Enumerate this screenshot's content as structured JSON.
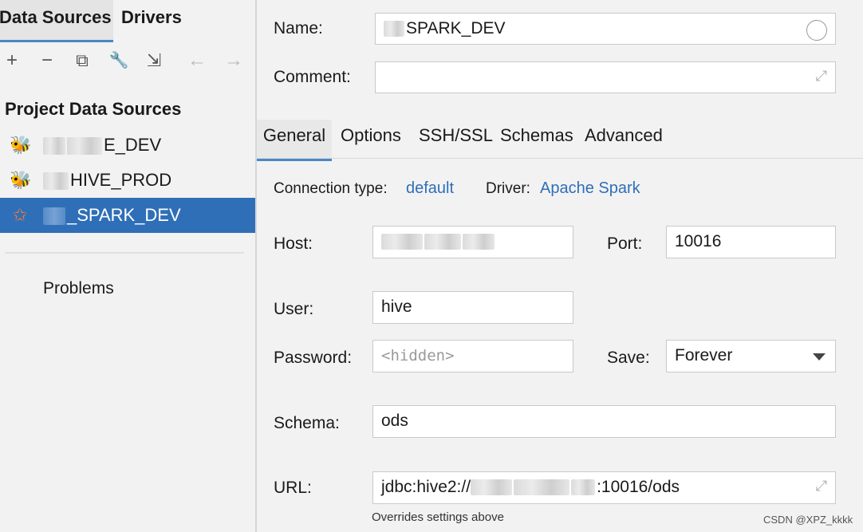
{
  "left": {
    "tabs": [
      {
        "label": "Data Sources",
        "active": true
      },
      {
        "label": "Drivers",
        "active": false
      }
    ],
    "toolbar": {
      "add": "+",
      "remove": "−",
      "duplicate": "⧉",
      "settings": "🔧",
      "import": "⇲",
      "back": "←",
      "forward": "→"
    },
    "section_title": "Project Data Sources",
    "items": [
      {
        "label": "E_DEV",
        "icon": "hive-icon",
        "selected": false
      },
      {
        "label": "HIVE_PROD",
        "icon": "hive-icon",
        "selected": false
      },
      {
        "label": "_SPARK_DEV",
        "icon": "spark-icon",
        "selected": true
      }
    ],
    "problems": "Problems"
  },
  "form": {
    "name_label": "Name:",
    "name_value": "SPARK_DEV",
    "comment_label": "Comment:",
    "comment_value": "",
    "tabs": [
      "General",
      "Options",
      "SSH/SSL",
      "Schemas",
      "Advanced"
    ],
    "connection_type_label": "Connection type:",
    "connection_type_value": "default",
    "driver_label": "Driver:",
    "driver_value": "Apache Spark",
    "host_label": "Host:",
    "host_value": "",
    "port_label": "Port:",
    "port_value": "10016",
    "user_label": "User:",
    "user_value": "hive",
    "password_label": "Password:",
    "password_placeholder": "<hidden>",
    "save_label": "Save:",
    "save_value": "Forever",
    "schema_label": "Schema:",
    "schema_value": "ods",
    "url_label": "URL:",
    "url_prefix": "jdbc:hive2://",
    "url_suffix": ":10016/ods",
    "url_note": "Overrides settings above"
  },
  "watermark": "CSDN @XPZ_kkkk",
  "colors": {
    "accent": "#2f6fb8",
    "tab_underline": "#4a88c7",
    "background": "#f2f2f2"
  }
}
